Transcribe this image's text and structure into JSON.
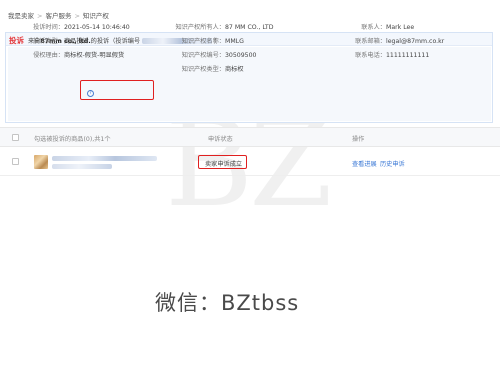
{
  "breadcrumb": [
    "我是卖家",
    "客户服务",
    "知识产权"
  ],
  "complaint": {
    "tag": "投诉",
    "prefix": "来自",
    "company": "87mm co., ltd.",
    "suffix": "的投诉（投诉编号",
    "close": "）"
  },
  "info": {
    "col1": [
      {
        "label": "投诉时间：",
        "value": "2021-05-14 10:46:40"
      },
      {
        "label": "投诉类型：",
        "value": "商品投诉"
      },
      {
        "label": "侵权理由：",
        "value": "商标权-假货-明显假货"
      }
    ],
    "col2": [
      {
        "label": "知识产权所有人：",
        "value": "87 MM CO., LTD"
      },
      {
        "label": "知识产权名称：",
        "value": "MMLG"
      },
      {
        "label": "知识产权编号：",
        "value": "30509500"
      },
      {
        "label": "知识产权类型：",
        "value": "商标权"
      }
    ],
    "col3": [
      {
        "label": "联系人：",
        "value": "Mark Lee"
      },
      {
        "label": "联系邮箱：",
        "value": "legal@87mm.co.kr"
      },
      {
        "label": "联系电话：",
        "value": "11111111111"
      }
    ]
  },
  "table": {
    "col_goods": "勾选被投诉的商品(0),共1个",
    "col_status": "申诉状态",
    "col_ops": "操作"
  },
  "rows": [
    {
      "status": "卖家申诉成立",
      "op1": "查看进展",
      "op2": "历史申诉"
    }
  ],
  "watermark": {
    "big": "BZ",
    "caption": "微信：BZtbss"
  },
  "colors": {
    "accent_red": "#e02020",
    "link_blue": "#3a78d6",
    "panel_border": "#d6e3f5"
  },
  "icons": {
    "help": "question-circle-icon"
  }
}
